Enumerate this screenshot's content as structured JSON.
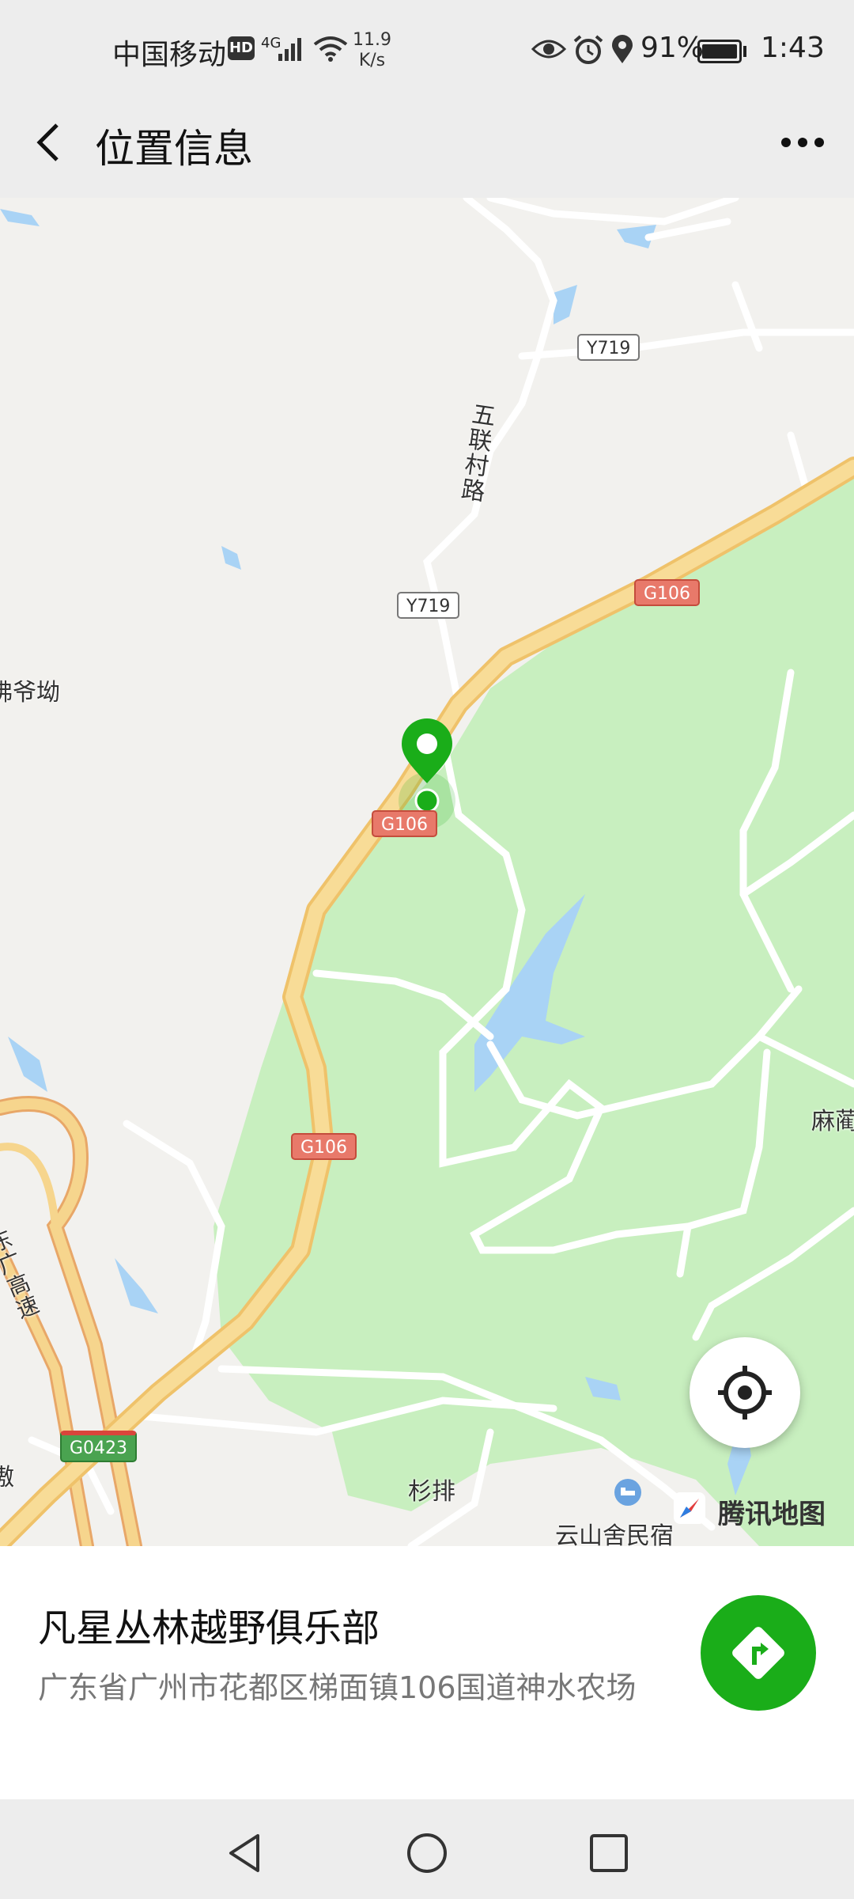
{
  "status_bar": {
    "carrier": "中国移动",
    "hd": "HD",
    "network": "4G",
    "speed": "11.9",
    "speed_unit": "K/s",
    "battery": "91%",
    "battery_level": 0.91,
    "time": "1:43",
    "icons": [
      "eye-icon",
      "alarm-icon",
      "location-icon"
    ]
  },
  "header": {
    "title": "位置信息"
  },
  "map": {
    "labels": {
      "village_road": "五联村路",
      "fo_ye_ao": "佛爷坳",
      "shan_pai": "杉排",
      "ma_ling": "麻蔺",
      "yunshan": "云山舍民宿",
      "dongguang": "东广高速",
      "edge_char": "傲"
    },
    "shields": {
      "y719_a": "Y719",
      "y719_b": "Y719",
      "g106_a": "G106",
      "g106_b": "G106",
      "g106_c": "G106",
      "g0423": "G0423"
    },
    "brand": "腾讯地图",
    "colors": {
      "land": "#f2f1ee",
      "forest": "#c8efbf",
      "water": "#a9d3f5",
      "highway": "#f6d58d",
      "pin": "#1aad19"
    }
  },
  "place": {
    "name": "凡星丛林越野俱乐部",
    "address": "广东省广州市花都区梯面镇106国道神水农场"
  },
  "nav_bar": {
    "buttons": [
      "back",
      "home",
      "recents"
    ]
  }
}
